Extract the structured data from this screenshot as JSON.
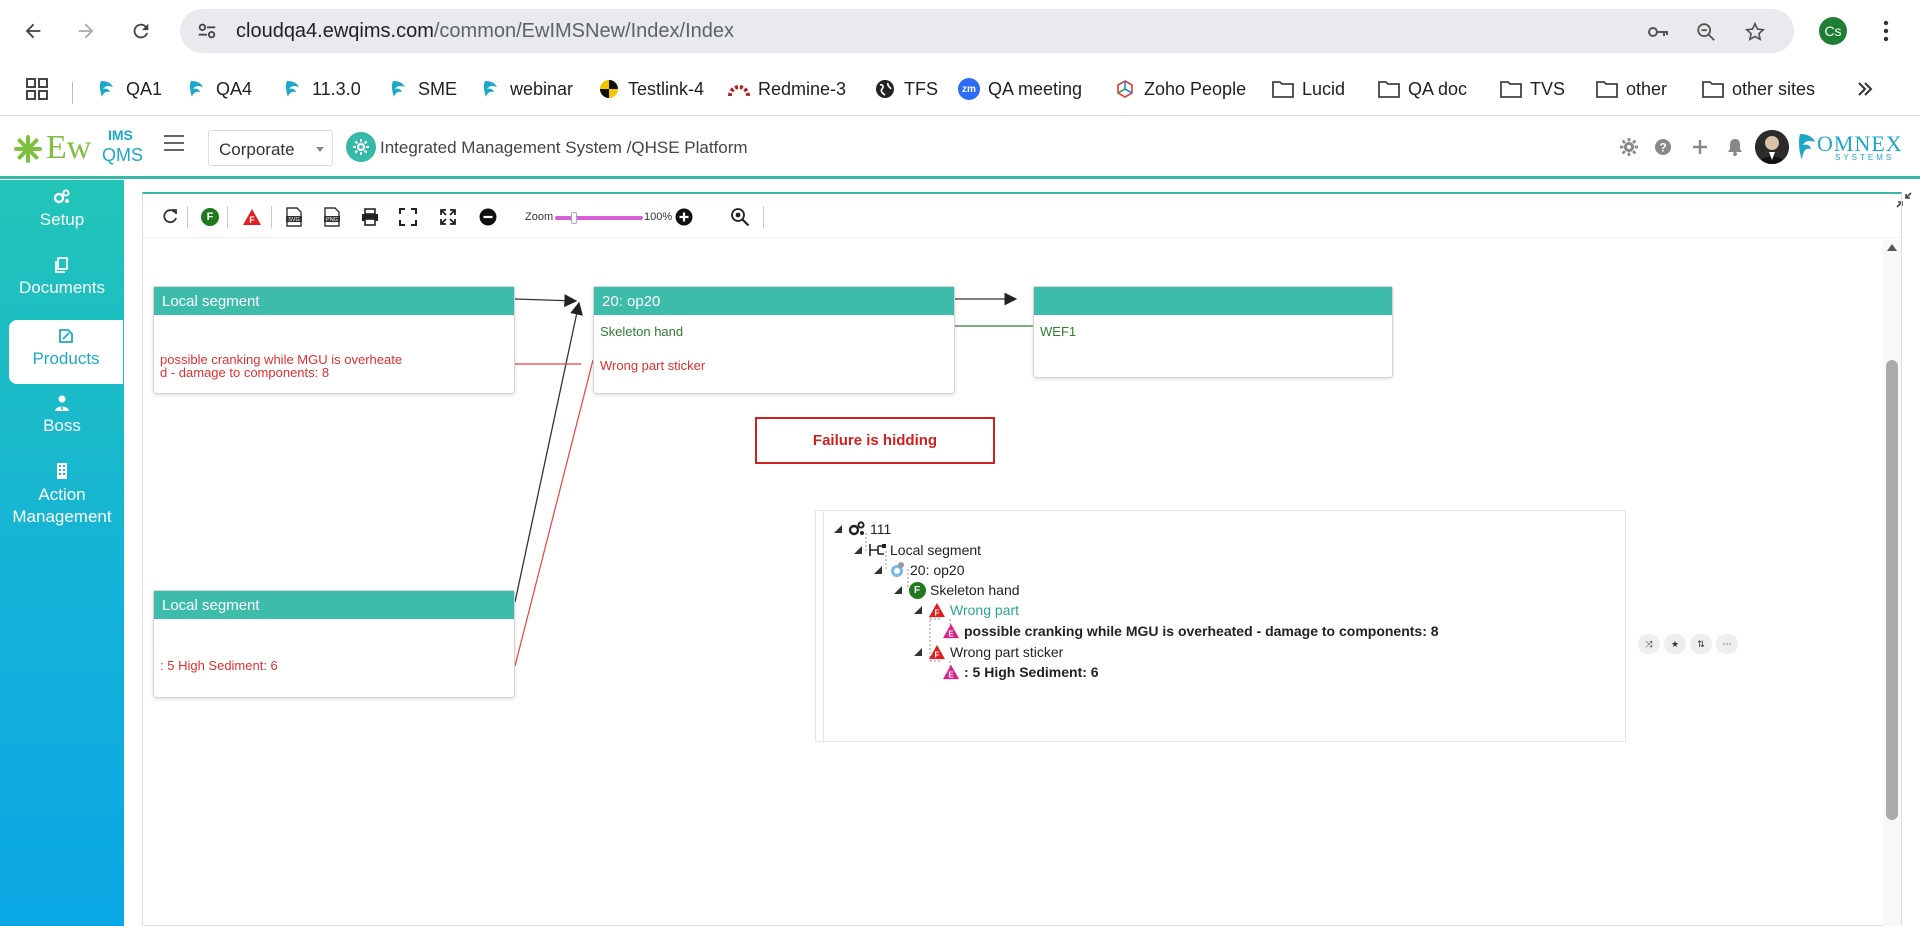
{
  "browser": {
    "url_host": "cloudqa4.ewqims.com",
    "url_path": "/common/EwIMSNew/Index/Index",
    "profile_initials": "Cs"
  },
  "bookmarks": [
    {
      "label": "QA1",
      "icon": "ewqims-icon"
    },
    {
      "label": "QA4",
      "icon": "ewqims-icon"
    },
    {
      "label": "11.3.0",
      "icon": "ewqims-icon"
    },
    {
      "label": "SME",
      "icon": "ewqims-icon"
    },
    {
      "label": "webinar",
      "icon": "ewqims-icon"
    },
    {
      "label": "Testlink-4",
      "icon": "testlink-icon"
    },
    {
      "label": "Redmine-3",
      "icon": "redmine-icon"
    },
    {
      "label": "TFS",
      "icon": "globe-icon"
    },
    {
      "label": "QA meeting",
      "icon": "zoom-icon",
      "icon_text": "zm"
    },
    {
      "label": "Zoho People",
      "icon": "zoho-icon"
    },
    {
      "label": "Lucid",
      "icon": "folder-icon"
    },
    {
      "label": "QA doc",
      "icon": "folder-icon"
    },
    {
      "label": "TVS",
      "icon": "folder-icon"
    },
    {
      "label": "other",
      "icon": "folder-icon"
    },
    {
      "label": "other sites",
      "icon": "folder-icon"
    }
  ],
  "header": {
    "logo_main": "Ew",
    "logo_top": "IMS",
    "logo_bottom": "QMS",
    "corporate_select": "Corporate",
    "platform_title": "Integrated Management System /QHSE Platform",
    "omnex_logo": "OMNEX",
    "omnex_sub": "SYSTEMS"
  },
  "sidebar": {
    "items": [
      {
        "label": "Setup",
        "icon": "gears-icon"
      },
      {
        "label": "Documents",
        "icon": "copy-icon"
      },
      {
        "label": "Products",
        "icon": "product-icon"
      },
      {
        "label": "Boss",
        "icon": "user-tie-icon"
      },
      {
        "label": "Action Management",
        "icon": "building-icon"
      }
    ],
    "active": "Products"
  },
  "toolbar": {
    "f_badge": "F",
    "zoom_label": "Zoom",
    "zoom_value": "100%",
    "zoom_percent": 100
  },
  "diagram": {
    "node_a": {
      "title": "Local segment",
      "line1": "possible cranking while MGU is overheate",
      "line2": "d - damage to components: 8"
    },
    "node_b": {
      "title": "20: op20",
      "line1": "Skeleton hand",
      "line2": "Wrong part sticker"
    },
    "node_c": {
      "title": "",
      "line1": "WEF1"
    },
    "node_d": {
      "title": "Local segment",
      "line1": ": 5  High Sediment: 6"
    },
    "failure_box": "Failure is hidding"
  },
  "tree": {
    "root": "111",
    "segment": "Local segment",
    "operation": "20: op20",
    "function": "Skeleton hand",
    "function_badge": "F",
    "failure1": "Wrong part",
    "effect1": "possible cranking while MGU is overheated - damage to components: 8",
    "failure2": "Wrong part sticker",
    "effect2": ": 5 High Sediment: 6",
    "effect_badge": "E",
    "failure_badge": "F"
  }
}
